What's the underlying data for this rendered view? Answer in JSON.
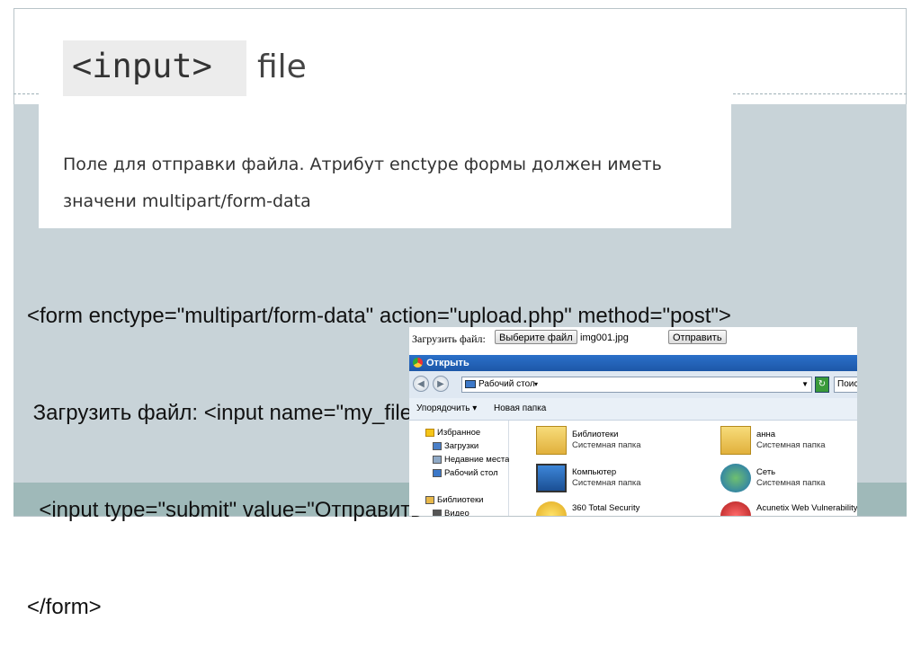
{
  "slide": {
    "code_tag": "<input>",
    "title_word": "file",
    "desc_line1": "Поле для отправки файла. Атрибут enctype формы должен иметь",
    "desc_line2": "значени multipart/form-data",
    "code": [
      "<form enctype=\"multipart/form-data\" action=\"upload.php\" method=\"post\">",
      " Загрузить файл: <input name=\"my_file\" type=\"file\">",
      "  <input type=\"submit\" value=\"Отправить\">",
      "</form>"
    ]
  },
  "screenshot": {
    "upload_label": "Загрузить файл:",
    "choose_button": "Выберите файл",
    "file_name": "img001.jpg",
    "submit_button": "Отправить",
    "dialog_title": "Открыть",
    "address": "Рабочий стол",
    "search_placeholder": "Поис",
    "toolbar": {
      "organize": "Упорядочить ▾",
      "new_folder": "Новая папка"
    },
    "sidebar": [
      "Избранное",
      "Загрузки",
      "Недавние места",
      "Рабочий стол",
      "Библиотеки",
      "Видео"
    ],
    "items": [
      {
        "name": "Библиотеки",
        "sub": "Системная папка"
      },
      {
        "name": "анна",
        "sub": "Системная папка"
      },
      {
        "name": "Компьютер",
        "sub": "Системная папка"
      },
      {
        "name": "Сеть",
        "sub": "Системная папка"
      },
      {
        "name": "360 Total Security",
        "sub": ""
      },
      {
        "name": "Acunetix Web Vulnerability Sc",
        "sub": ""
      }
    ]
  }
}
